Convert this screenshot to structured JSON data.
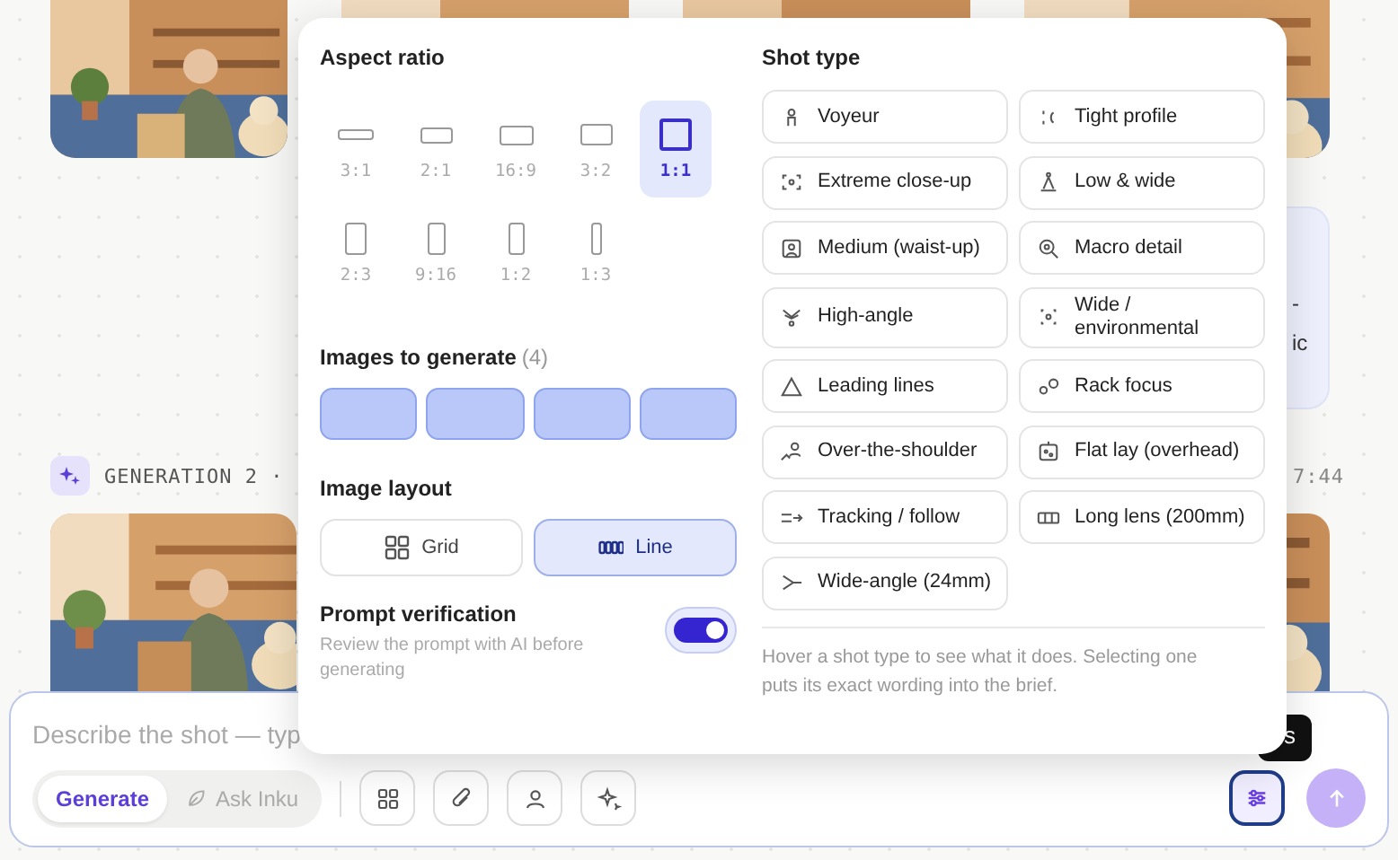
{
  "side_card": {
    "lines": [
      "-",
      "ic"
    ]
  },
  "generation": {
    "label": "GENERATION 2 ·",
    "time": "7:44"
  },
  "composer": {
    "placeholder": "Describe the shot — typ",
    "modes": [
      {
        "label": "Generate",
        "selected": true
      },
      {
        "label": "Ask Inku",
        "selected": false
      }
    ],
    "settings_active": true,
    "tooltip": "s"
  },
  "popover": {
    "aspect_ratio": {
      "title": "Aspect ratio",
      "options": [
        {
          "label": "3:1",
          "selected": false
        },
        {
          "label": "2:1",
          "selected": false
        },
        {
          "label": "16:9",
          "selected": false
        },
        {
          "label": "3:2",
          "selected": false
        },
        {
          "label": "1:1",
          "selected": true
        },
        {
          "label": "2:3",
          "selected": false
        },
        {
          "label": "9:16",
          "selected": false
        },
        {
          "label": "1:2",
          "selected": false
        },
        {
          "label": "1:3",
          "selected": false
        }
      ]
    },
    "images": {
      "title": "Images to generate",
      "count": "(4)",
      "slots": [
        {
          "filled": true
        },
        {
          "filled": true
        },
        {
          "filled": true
        },
        {
          "filled": true
        }
      ]
    },
    "layout": {
      "title": "Image layout",
      "options": [
        {
          "label": "Grid",
          "selected": false
        },
        {
          "label": "Line",
          "selected": true
        }
      ]
    },
    "verification": {
      "title": "Prompt verification",
      "description": "Review the prompt with AI before generating",
      "on": true
    },
    "shots": {
      "title": "Shot type",
      "options": [
        {
          "label": "Voyeur",
          "selected": false
        },
        {
          "label": "Tight profile",
          "selected": false
        },
        {
          "label": "Extreme close-up",
          "selected": false
        },
        {
          "label": "Low & wide",
          "selected": false
        },
        {
          "label": "Medium (waist-up)",
          "selected": false
        },
        {
          "label": "Macro detail",
          "selected": false
        },
        {
          "label": "High-angle",
          "selected": false
        },
        {
          "label": "Wide / environmental",
          "selected": false
        },
        {
          "label": "Leading lines",
          "selected": false
        },
        {
          "label": "Rack focus",
          "selected": false
        },
        {
          "label": "Over-the-shoulder",
          "selected": false
        },
        {
          "label": "Flat lay (overhead)",
          "selected": false
        },
        {
          "label": "Tracking / follow",
          "selected": false
        },
        {
          "label": "Long lens (200mm)",
          "selected": false
        },
        {
          "label": "Wide-angle (24mm)",
          "selected": false
        }
      ],
      "hint": "Hover a shot type to see what it does. Selecting one puts its exact wording into the brief."
    }
  }
}
